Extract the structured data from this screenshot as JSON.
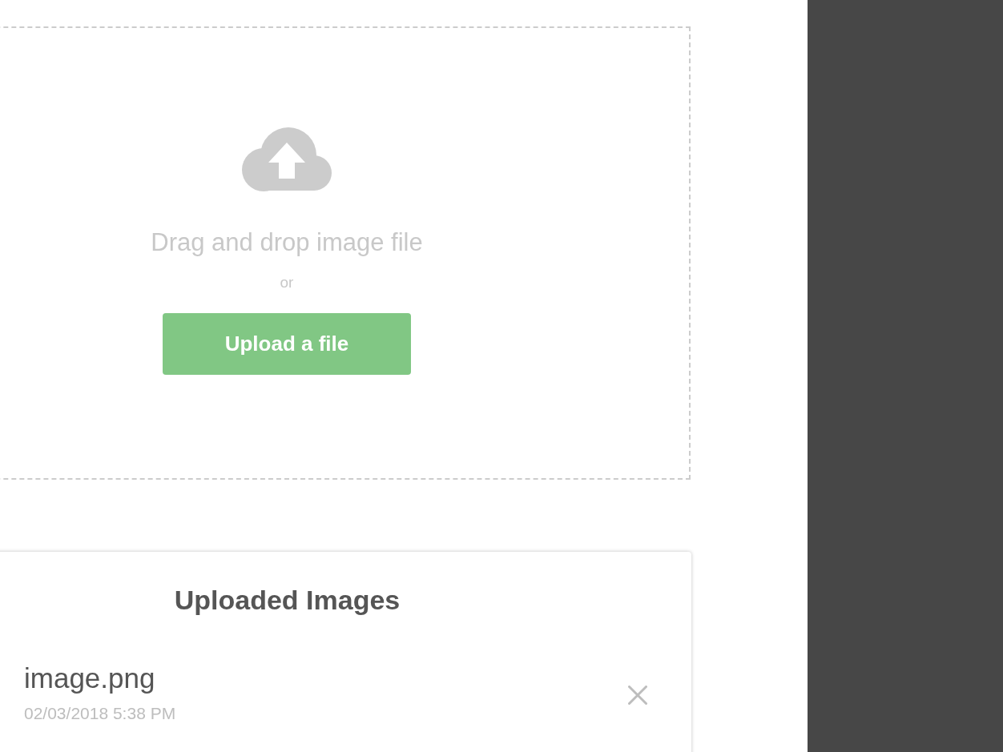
{
  "upload_area": {
    "prompt": "Drag and drop image file",
    "separator": "or",
    "button": "Upload a file"
  },
  "uploaded_images": {
    "title": "Uploaded Images",
    "items": [
      {
        "name": "image.png",
        "date": "02/03/2018 5:38 PM"
      }
    ]
  }
}
